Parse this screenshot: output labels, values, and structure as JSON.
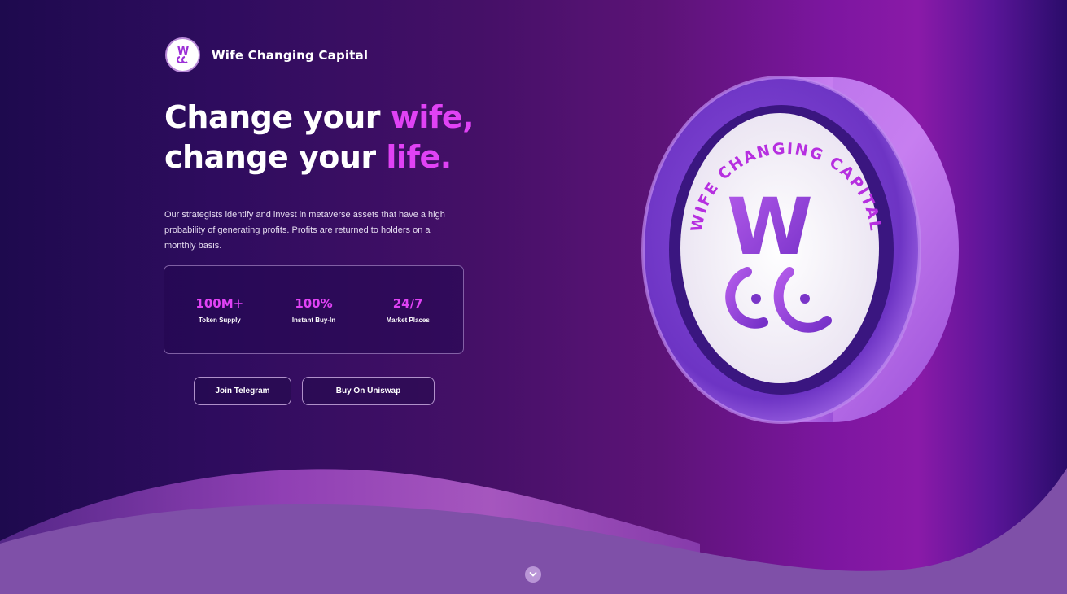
{
  "brand": {
    "name": "Wife Changing Capital",
    "logo_icon": "wcc-logo-icon"
  },
  "hero": {
    "title_line1_a": "Change your ",
    "title_line1_b": "wife,",
    "title_line2_a": "change your ",
    "title_line2_b": "life.",
    "description": "Our strategists identify and invest in metaverse assets that have a high probability of generating profits. Profits are returned to holders on a monthly basis."
  },
  "stats": [
    {
      "value": "100M+",
      "label": "Token Supply"
    },
    {
      "value": "100%",
      "label": "Instant Buy-In"
    },
    {
      "value": "24/7",
      "label": "Market Places"
    }
  ],
  "buttons": {
    "telegram": "Join Telegram",
    "uniswap": "Buy On Uniswap"
  },
  "coin": {
    "ring_text": "WIFE CHANGING CAPITAL",
    "monogram": "W"
  },
  "icons": {
    "scroll": "chevron-down-icon"
  },
  "colors": {
    "accent": "#e042f5",
    "background_dark": "#1e0a4e",
    "wave": "#7f50a8"
  }
}
